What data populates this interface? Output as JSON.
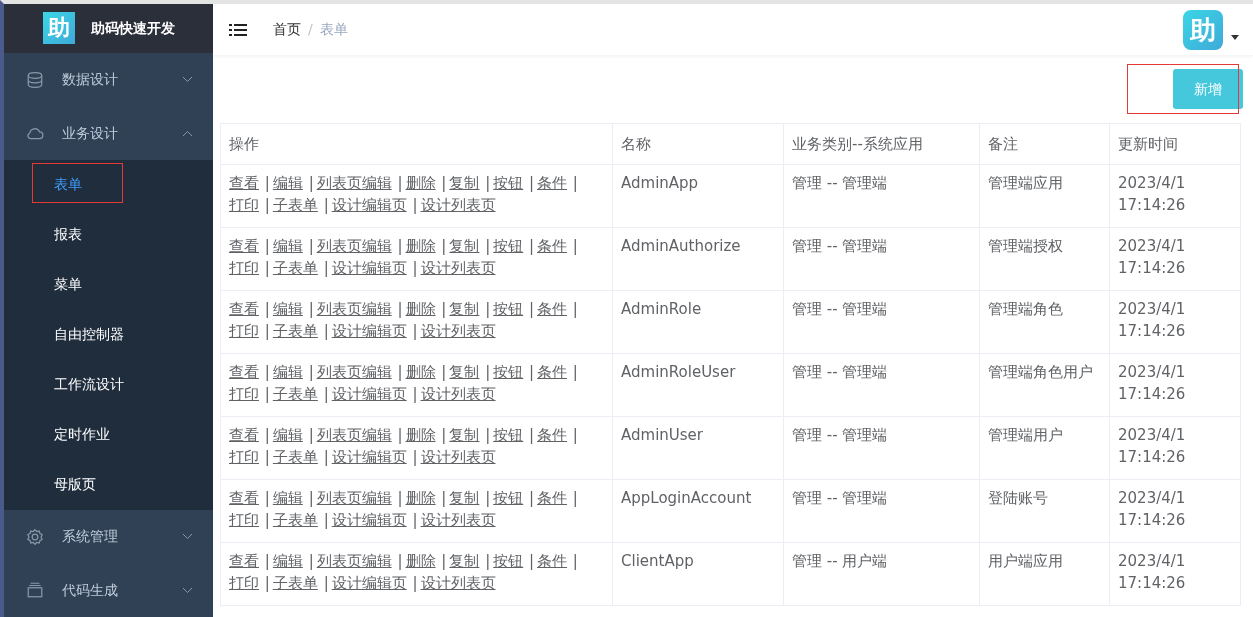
{
  "brand": {
    "logo": "助",
    "title": "助码快速开发"
  },
  "sidebar": {
    "groups": [
      {
        "label": "数据设计",
        "expanded": false
      },
      {
        "label": "业务设计",
        "expanded": true,
        "children": [
          {
            "label": "表单",
            "selected": true,
            "highlighted": true
          },
          {
            "label": "报表",
            "selected": false,
            "highlighted": false
          },
          {
            "label": "菜单",
            "selected": false,
            "highlighted": false
          },
          {
            "label": "自由控制器",
            "selected": false,
            "highlighted": false
          },
          {
            "label": "工作流设计",
            "selected": false,
            "highlighted": false
          },
          {
            "label": "定时作业",
            "selected": false,
            "highlighted": false
          },
          {
            "label": "母版页",
            "selected": false,
            "highlighted": false
          }
        ]
      },
      {
        "label": "系统管理",
        "expanded": false
      },
      {
        "label": "代码生成",
        "expanded": false
      }
    ]
  },
  "breadcrumb": {
    "items": [
      "首页",
      "表单"
    ],
    "separator": "/"
  },
  "user": {
    "avatar": "助"
  },
  "add_button": {
    "label": "新增",
    "highlighted": true
  },
  "table": {
    "columns": [
      "操作",
      "名称",
      "业务类别--系统应用",
      "备注",
      "更新时间"
    ],
    "action_separator": "|",
    "rows": [
      {
        "actions": [
          "查看",
          "编辑",
          "列表页编辑",
          "删除",
          "复制",
          "按钮",
          "条件",
          "打印",
          "子表单",
          "设计编辑页",
          "设计列表页"
        ],
        "name": "AdminApp",
        "category": "管理 -- 管理端",
        "remark": "管理端应用",
        "updated": [
          "2023/4/1",
          "17:14:26"
        ]
      },
      {
        "actions": [
          "查看",
          "编辑",
          "列表页编辑",
          "删除",
          "复制",
          "按钮",
          "条件",
          "打印",
          "子表单",
          "设计编辑页",
          "设计列表页"
        ],
        "name": "AdminAuthorize",
        "category": "管理 -- 管理端",
        "remark": "管理端授权",
        "updated": [
          "2023/4/1",
          "17:14:26"
        ]
      },
      {
        "actions": [
          "查看",
          "编辑",
          "列表页编辑",
          "删除",
          "复制",
          "按钮",
          "条件",
          "打印",
          "子表单",
          "设计编辑页",
          "设计列表页"
        ],
        "name": "AdminRole",
        "category": "管理 -- 管理端",
        "remark": "管理端角色",
        "updated": [
          "2023/4/1",
          "17:14:26"
        ]
      },
      {
        "actions": [
          "查看",
          "编辑",
          "列表页编辑",
          "删除",
          "复制",
          "按钮",
          "条件",
          "打印",
          "子表单",
          "设计编辑页",
          "设计列表页"
        ],
        "name": "AdminRoleUser",
        "category": "管理 -- 管理端",
        "remark": "管理端角色用户",
        "updated": [
          "2023/4/1",
          "17:14:26"
        ]
      },
      {
        "actions": [
          "查看",
          "编辑",
          "列表页编辑",
          "删除",
          "复制",
          "按钮",
          "条件",
          "打印",
          "子表单",
          "设计编辑页",
          "设计列表页"
        ],
        "name": "AdminUser",
        "category": "管理 -- 管理端",
        "remark": "管理端用户",
        "updated": [
          "2023/4/1",
          "17:14:26"
        ]
      },
      {
        "actions": [
          "查看",
          "编辑",
          "列表页编辑",
          "删除",
          "复制",
          "按钮",
          "条件",
          "打印",
          "子表单",
          "设计编辑页",
          "设计列表页"
        ],
        "name": "AppLoginAccount",
        "category": "管理 -- 管理端",
        "remark": "登陆账号",
        "updated": [
          "2023/4/1",
          "17:14:26"
        ]
      },
      {
        "actions": [
          "查看",
          "编辑",
          "列表页编辑",
          "删除",
          "复制",
          "按钮",
          "条件",
          "打印",
          "子表单",
          "设计编辑页",
          "设计列表页"
        ],
        "name": "ClientApp",
        "category": "管理 -- 用户端",
        "remark": "用户端应用",
        "updated": [
          "2023/4/1",
          "17:14:26"
        ]
      }
    ]
  }
}
